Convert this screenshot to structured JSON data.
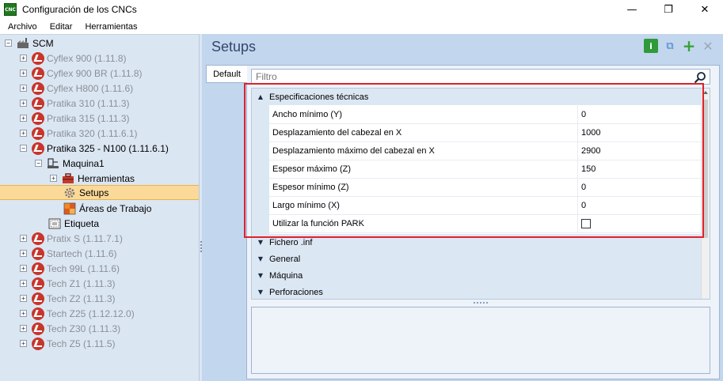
{
  "window": {
    "app_icon_text": "CNC",
    "title": "Configuración de los CNCs",
    "minimize": "—",
    "maximize": "❐",
    "close": "✕"
  },
  "menu": [
    "Archivo",
    "Editar",
    "Herramientas"
  ],
  "tree": {
    "root": "SCM",
    "machines_before": [
      "Cyflex 900 (1.11.8)",
      "Cyflex 900 BR (1.11.8)",
      "Cyflex H800 (1.11.6)",
      "Pratika 310 (1.11.3)",
      "Pratika 315 (1.11.3)",
      "Pratika 320 (1.11.6.1)"
    ],
    "expanded_machine": "Pratika 325 - N100 (1.11.6.1)",
    "machine_node": "Maquina1",
    "machine_children": [
      "Herramientas",
      "Setups",
      "Áreas de Trabajo"
    ],
    "label_node": "Etiqueta",
    "machines_after": [
      "Pratix S (1.11.7.1)",
      "Startech (1.11.6)",
      "Tech 99L (1.11.6)",
      "Tech Z1 (1.11.3)",
      "Tech Z2 (1.11.3)",
      "Tech Z25 (1.12.12.0)",
      "Tech Z30 (1.11.3)",
      "Tech Z5 (1.11.5)"
    ]
  },
  "main": {
    "title": "Setups",
    "toolbar": {
      "info": "i",
      "copy": "⧉",
      "add": "+",
      "delete": "✕"
    },
    "tab": "Default",
    "filter_placeholder": "Filtro",
    "expanded_section": {
      "label": "Especificaciones técnicas",
      "properties": [
        {
          "name": "Ancho mínimo (Y)",
          "value": "0"
        },
        {
          "name": "Desplazamiento del cabezal en X",
          "value": "1000"
        },
        {
          "name": "Desplazamiento máximo del cabezal en X",
          "value": "2900"
        },
        {
          "name": "Espesor máximo (Z)",
          "value": "150"
        },
        {
          "name": "Espesor mínimo (Z)",
          "value": "0"
        },
        {
          "name": "Largo mínimo (X)",
          "value": "0"
        },
        {
          "name": "Utilizar la función PARK",
          "value": ""
        }
      ]
    },
    "collapsed_sections": [
      "Fichero .inf",
      "General",
      "Máquina",
      "Perforaciones"
    ]
  },
  "colors": {
    "highlight": "#e0212b",
    "selected": "#fbd999",
    "panel": "#dbe6f3"
  }
}
